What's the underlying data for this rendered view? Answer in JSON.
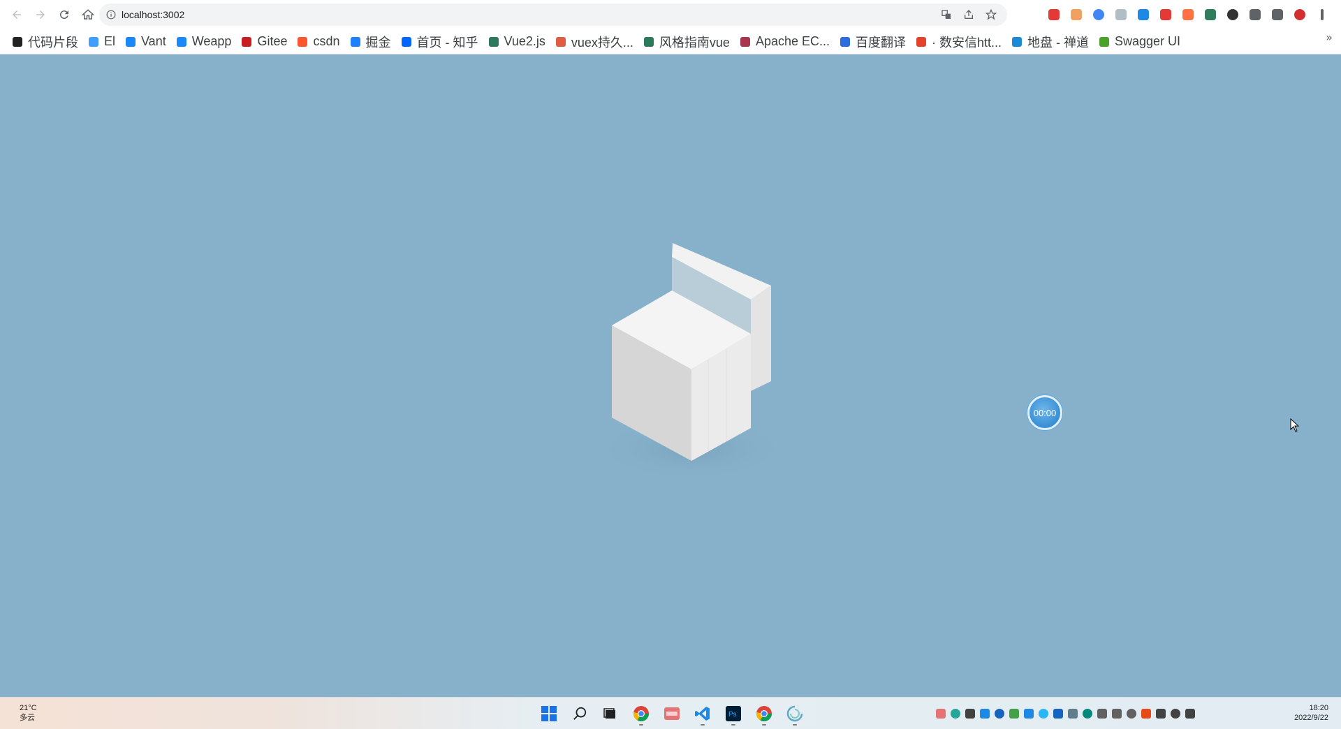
{
  "browser": {
    "url": "localhost:3002",
    "nav": [
      "back-icon",
      "forward-icon",
      "reload-icon",
      "home-icon"
    ],
    "omnibox_actions": [
      "translate-icon",
      "share-icon",
      "bookmark-star-icon"
    ]
  },
  "extensions": [
    {
      "name": "heart-extension-icon",
      "color": "#e53935"
    },
    {
      "name": "orange-extension-icon",
      "color": "#f0a060"
    },
    {
      "name": "color-ring-extension-icon",
      "color": "#4285f4"
    },
    {
      "name": "screen-extension-icon",
      "color": "#b0bec5"
    },
    {
      "name": "sync-extension-icon",
      "color": "#1e88e5"
    },
    {
      "name": "red-box-extension-icon",
      "color": "#e53935"
    },
    {
      "name": "glasses-extension-icon",
      "color": "#ff7043"
    },
    {
      "name": "vue-extension-icon",
      "color": "#2e7d5b"
    },
    {
      "name": "circle-extension-icon",
      "color": "#333333"
    },
    {
      "name": "puzzle-extensions-icon",
      "color": "#5f6368"
    },
    {
      "name": "side-panel-icon",
      "color": "#5f6368"
    },
    {
      "name": "profile-avatar-icon",
      "color": "#d32f2f"
    },
    {
      "name": "menu-kebab-icon",
      "color": "#5f6368"
    }
  ],
  "bookmarks": [
    {
      "label": "代码片段",
      "color": "#222222"
    },
    {
      "label": "El",
      "color": "#409eff"
    },
    {
      "label": "Vant",
      "color": "#1989fa"
    },
    {
      "label": "Weapp",
      "color": "#1989fa"
    },
    {
      "label": "Gitee",
      "color": "#c71d23"
    },
    {
      "label": "csdn",
      "color": "#fc5531"
    },
    {
      "label": "掘金",
      "color": "#1e80ff"
    },
    {
      "label": "首页 - 知乎",
      "color": "#0066ff"
    },
    {
      "label": "Vue2.js",
      "color": "#2c7a5b"
    },
    {
      "label": "vuex持久...",
      "color": "#e05d44"
    },
    {
      "label": "风格指南vue",
      "color": "#2c7a5b"
    },
    {
      "label": "Apache EC...",
      "color": "#aa344d"
    },
    {
      "label": "百度翻译",
      "color": "#2d6cdf"
    },
    {
      "label": "· 数安信htt...",
      "color": "#e2432a"
    },
    {
      "label": "地盘 - 禅道",
      "color": "#1a8ad6"
    },
    {
      "label": "Swagger UI",
      "color": "#49a32b"
    }
  ],
  "bookmarks_overflow": "»",
  "scene": {
    "timer": "00:00",
    "background": "#87b1cb"
  },
  "taskbar": {
    "weather_temp": "21°C",
    "weather_desc": "多云",
    "time": "18:20",
    "date": "2022/9/22",
    "apps": [
      "windows-start-icon",
      "search-icon",
      "task-view-icon",
      "chrome-icon",
      "lala-app-icon",
      "vscode-icon",
      "photoshop-icon",
      "chrome-alt-icon",
      "loading-app-icon"
    ],
    "tray": [
      {
        "name": "tray-app-icon-1",
        "color": "#e57373"
      },
      {
        "name": "tray-app-icon-2",
        "color": "#26a69a"
      },
      {
        "name": "tray-app-icon-3",
        "color": "#424242"
      },
      {
        "name": "tray-app-icon-4",
        "color": "#1e88e5"
      },
      {
        "name": "tray-app-icon-5",
        "color": "#1565c0"
      },
      {
        "name": "tray-app-icon-6",
        "color": "#43a047"
      },
      {
        "name": "tray-app-icon-7",
        "color": "#1e88e5"
      },
      {
        "name": "tray-app-icon-8",
        "color": "#29b6f6"
      },
      {
        "name": "bluetooth-icon",
        "color": "#1565c0"
      },
      {
        "name": "tray-app-icon-9",
        "color": "#607d8b"
      },
      {
        "name": "tray-app-icon-10",
        "color": "#00897b"
      },
      {
        "name": "cloud-icon",
        "color": "#616161"
      },
      {
        "name": "microphone-icon",
        "color": "#616161"
      },
      {
        "name": "input-method-icon",
        "color": "#616161"
      },
      {
        "name": "tray-app-icon-11",
        "color": "#e64a19"
      },
      {
        "name": "wifi-icon",
        "color": "#424242"
      },
      {
        "name": "volume-icon",
        "color": "#424242"
      },
      {
        "name": "battery-icon",
        "color": "#424242"
      }
    ]
  }
}
